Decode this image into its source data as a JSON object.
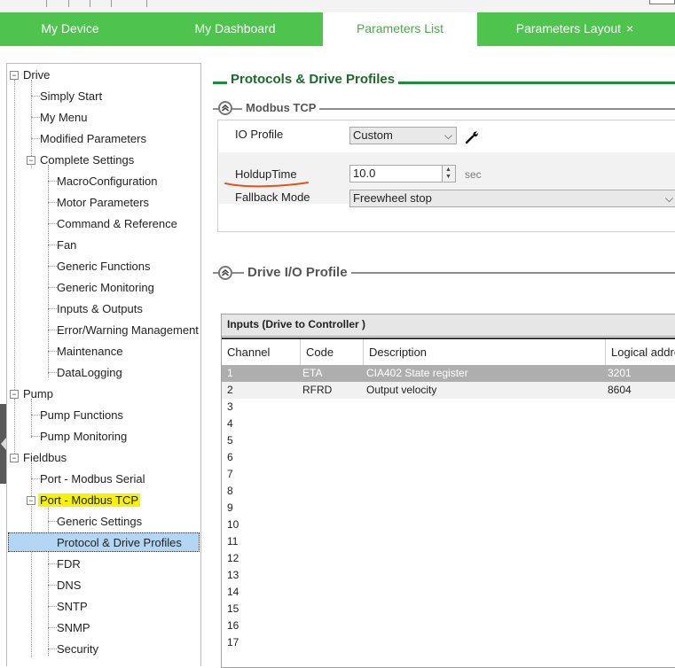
{
  "tabs": [
    {
      "label": "My Device"
    },
    {
      "label": "My Dashboard"
    },
    {
      "label": "Parameters List"
    },
    {
      "label": "Parameters Layout"
    }
  ],
  "tab_close_glyph": "×",
  "active_tab": "Parameters List",
  "tree": {
    "drive": {
      "label": "Drive"
    },
    "simply_start": {
      "label": "Simply Start"
    },
    "my_menu": {
      "label": "My Menu"
    },
    "modified_parameters": {
      "label": "Modified Parameters"
    },
    "complete_settings": {
      "label": "Complete Settings"
    },
    "macro_configuration": {
      "label": "MacroConfiguration"
    },
    "motor_parameters": {
      "label": "Motor Parameters"
    },
    "command_reference": {
      "label": "Command & Reference"
    },
    "fan": {
      "label": "Fan"
    },
    "generic_functions": {
      "label": "Generic Functions"
    },
    "generic_monitoring": {
      "label": "Generic Monitoring"
    },
    "inputs_outputs": {
      "label": "Inputs & Outputs"
    },
    "error_warning": {
      "label": "Error/Warning Management"
    },
    "maintenance": {
      "label": "Maintenance"
    },
    "datalogging": {
      "label": "DataLogging"
    },
    "pump": {
      "label": "Pump"
    },
    "pump_functions": {
      "label": "Pump Functions"
    },
    "pump_monitoring": {
      "label": "Pump Monitoring"
    },
    "fieldbus": {
      "label": "Fieldbus"
    },
    "port_modbus_serial": {
      "label": "Port - Modbus Serial"
    },
    "port_modbus_tcp": {
      "label": "Port - Modbus TCP"
    },
    "generic_settings": {
      "label": "Generic Settings"
    },
    "protocol_drive_profiles": {
      "label": "Protocol & Drive Profiles"
    },
    "fdr": {
      "label": "FDR"
    },
    "dns": {
      "label": "DNS"
    },
    "sntp": {
      "label": "SNTP"
    },
    "snmp": {
      "label": "SNMP"
    },
    "security": {
      "label": "Security"
    }
  },
  "main": {
    "section_title": "Protocols & Drive Profiles",
    "modbus_group": {
      "title": "Modbus TCP",
      "io_profile": {
        "label": "IO Profile",
        "value": "Custom"
      },
      "holdup_time": {
        "label": "HoldupTime",
        "value": "10.0",
        "unit": "sec"
      },
      "fallback_mode": {
        "label": "Fallback Mode",
        "value": "Freewheel stop"
      }
    },
    "drive_io_group": {
      "title": "Drive I/O Profile"
    },
    "inputs_table": {
      "caption": "Inputs (Drive to Controller )",
      "columns": [
        "Channel",
        "Code",
        "Description",
        "Logical addre"
      ],
      "rows": [
        [
          "1",
          "ETA",
          "CIA402 State register",
          "3201"
        ],
        [
          "2",
          "RFRD",
          "Output velocity",
          "8604"
        ],
        [
          "3",
          "",
          "",
          ""
        ],
        [
          "4",
          "",
          "",
          ""
        ],
        [
          "5",
          "",
          "",
          ""
        ],
        [
          "6",
          "",
          "",
          ""
        ],
        [
          "7",
          "",
          "",
          ""
        ],
        [
          "8",
          "",
          "",
          ""
        ],
        [
          "9",
          "",
          "",
          ""
        ],
        [
          "10",
          "",
          "",
          ""
        ],
        [
          "11",
          "",
          "",
          ""
        ],
        [
          "12",
          "",
          "",
          ""
        ],
        [
          "13",
          "",
          "",
          ""
        ],
        [
          "14",
          "",
          "",
          ""
        ],
        [
          "15",
          "",
          "",
          ""
        ],
        [
          "16",
          "",
          "",
          ""
        ],
        [
          "17",
          "",
          "",
          ""
        ]
      ]
    }
  },
  "icons": {
    "wrench": "wrench-icon",
    "collapse": "double-chevron-up-icon",
    "expand_toggle": "plus-minus-toggle-icon"
  },
  "colors": {
    "tab_bar": "#4ec34e",
    "active_tab_text": "#4ea84e",
    "section_title": "#1a6b2a",
    "highlight_yellow": "#f6f200",
    "selection_blue": "#b3d6f5",
    "annotation_underline": "#e0541a",
    "selected_row": "#aeaeae"
  }
}
